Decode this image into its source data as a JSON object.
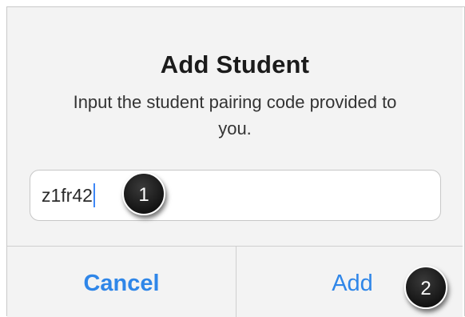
{
  "dialog": {
    "title": "Add Student",
    "message": "Input the student pairing code provided to you.",
    "input": {
      "value": "z1fr42",
      "placeholder": ""
    },
    "buttons": {
      "cancel_label": "Cancel",
      "add_label": "Add"
    }
  },
  "annotations": {
    "step_1": "1",
    "step_2": "2"
  },
  "colors": {
    "accent": "#2f86e8",
    "dialog_background": "#f3f3f3",
    "marker": "#141414"
  }
}
